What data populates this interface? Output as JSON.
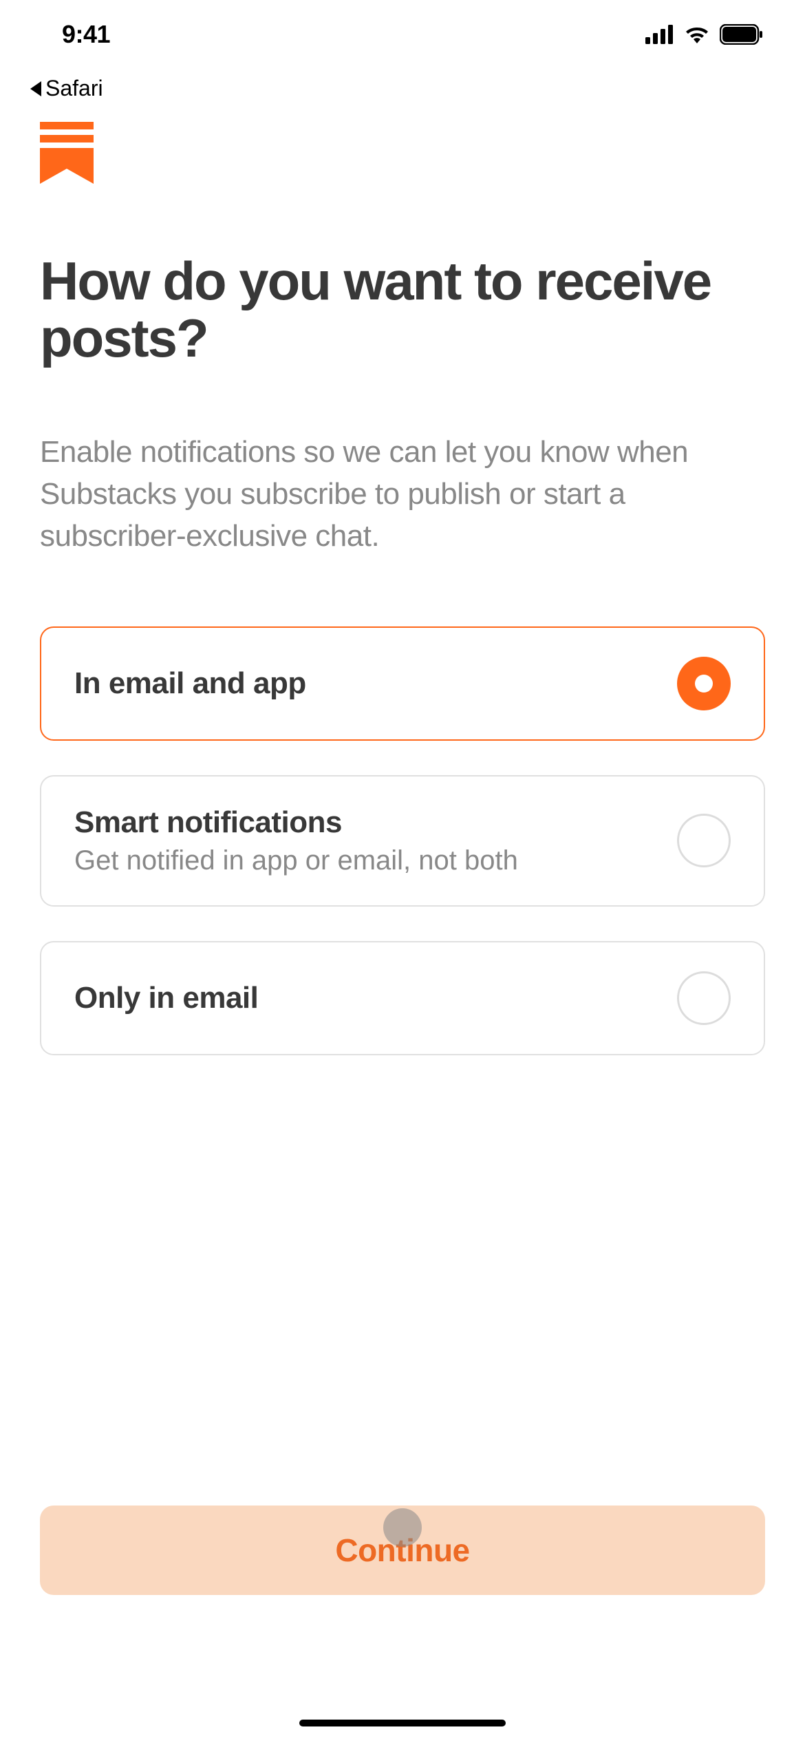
{
  "status": {
    "time": "9:41",
    "back_app": "Safari"
  },
  "brand": {
    "accent": "#ff6719"
  },
  "page": {
    "title": "How do you want to receive posts?",
    "subtitle": "Enable notifications so we can let you know when Substacks you subscribe to publish or start a subscriber-exclusive chat."
  },
  "options": [
    {
      "title": "In email and app",
      "subtitle": "",
      "selected": true
    },
    {
      "title": "Smart notifications",
      "subtitle": "Get notified in app or email, not both",
      "selected": false
    },
    {
      "title": "Only in email",
      "subtitle": "",
      "selected": false
    }
  ],
  "continue_label": "Continue"
}
